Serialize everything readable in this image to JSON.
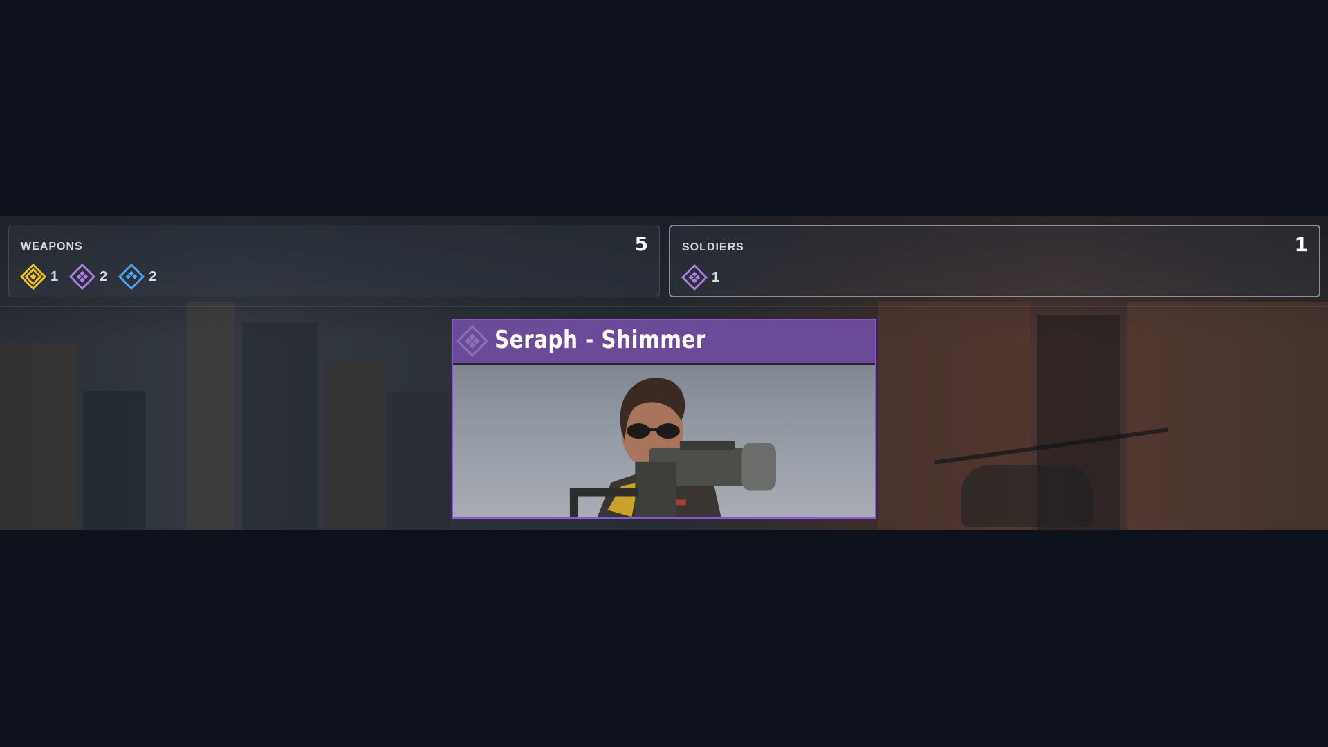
{
  "weapons": {
    "label": "WEAPONS",
    "total": "5",
    "items": [
      {
        "rarity": "legendary",
        "icon": "gold-rarity-diamond-icon",
        "color": "#f2c21b",
        "count": "1"
      },
      {
        "rarity": "epic",
        "icon": "purple-rarity-diamond-icon",
        "color": "#b07ce8",
        "count": "2"
      },
      {
        "rarity": "rare",
        "icon": "blue-rarity-diamond-icon",
        "color": "#4ea7ff",
        "count": "2"
      }
    ]
  },
  "soldiers": {
    "label": "SOLDIERS",
    "total": "1",
    "items": [
      {
        "rarity": "epic",
        "icon": "purple-rarity-diamond-icon",
        "color": "#b07ce8",
        "count": "1"
      }
    ]
  },
  "reward_card": {
    "title": "Seraph - Shimmer",
    "rarity": "epic",
    "accent": "#8c57d0",
    "header_color": "#6b4a99",
    "icon": "epic-rarity-diamond-icon"
  }
}
